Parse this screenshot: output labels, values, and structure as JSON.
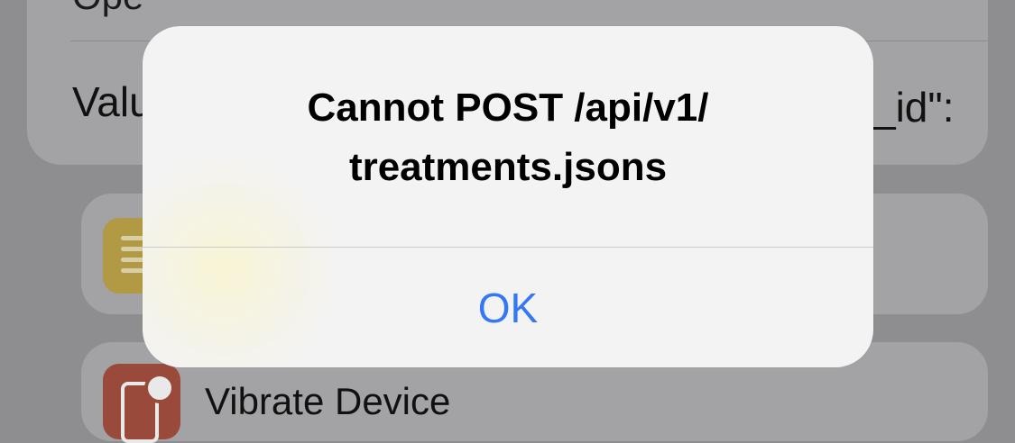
{
  "background": {
    "top_text": "Ope",
    "value_label": "Value",
    "value_end": "_id\":",
    "actions": [
      {
        "label": "",
        "icon": "text-icon"
      },
      {
        "label": "Vibrate Device",
        "icon": "vibrate-icon"
      }
    ]
  },
  "alert": {
    "title_line1": "Cannot POST /api/v1/",
    "title_line2": "treatments.jsons",
    "button_label": "OK",
    "button_color": "#3478f6"
  }
}
